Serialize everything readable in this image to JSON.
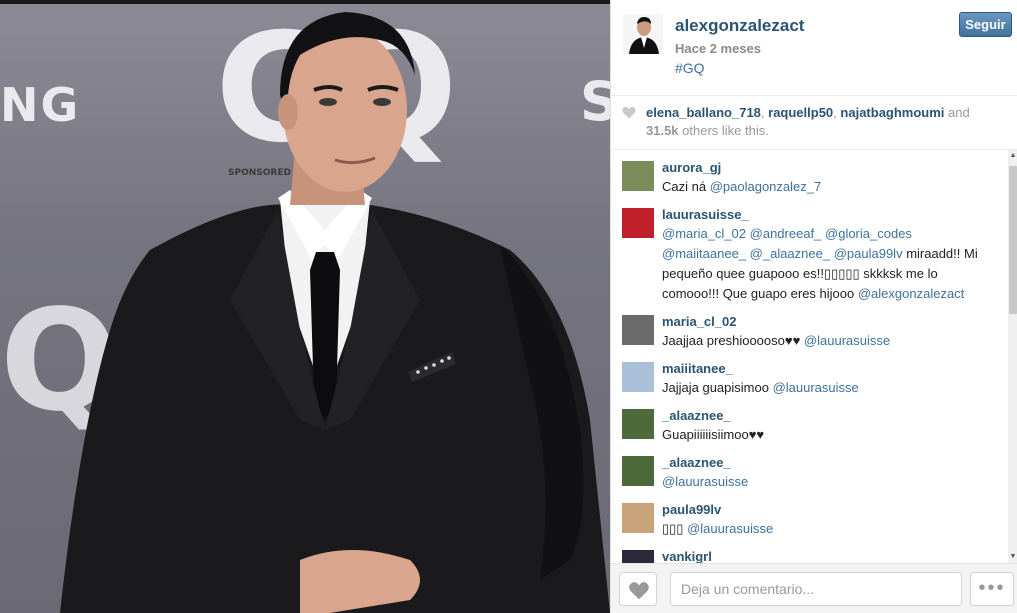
{
  "photo": {
    "alt_text": [
      "NG",
      "GQ",
      "S",
      "Q"
    ],
    "small_text": "SPONSORED BY"
  },
  "post": {
    "username": "alexgonzalezact",
    "time": "Hace 2 meses",
    "caption": "#GQ",
    "follow_label": "Seguir"
  },
  "likes": {
    "users": [
      "elena_ballano_718",
      "raquellp50",
      "najatbaghmoumi"
    ],
    "sep1": ", ",
    "sep2": ", ",
    "and": " and",
    "count": "31.5k",
    "suffix": " others like this."
  },
  "comments": [
    {
      "user": "aurora_gj",
      "parts": [
        {
          "t": "Cazi ná "
        },
        {
          "m": "@paolagonzalez_7"
        }
      ],
      "avatar_color": "#7a8c5a"
    },
    {
      "user": "lauurasuisse_",
      "parts": [
        {
          "m": "@maria_cl_02"
        },
        {
          "t": " "
        },
        {
          "m": "@andreeaf_"
        },
        {
          "t": " "
        },
        {
          "m": "@gloria_codes"
        },
        {
          "t": " "
        },
        {
          "m": "@maiitaanee_"
        },
        {
          "t": " "
        },
        {
          "m": "@_alaaznee_"
        },
        {
          "t": " "
        },
        {
          "m": "@paula99lv"
        },
        {
          "t": " miraadd!! Mi pequeño quee guapooo es!!▯▯▯▯▯ skkksk me lo comooo!!! Que guapo eres hijooo "
        },
        {
          "m": "@alexgonzalezact"
        }
      ],
      "avatar_color": "#c0202a"
    },
    {
      "user": "maria_cl_02",
      "parts": [
        {
          "t": "Jaajjaa preshiooooso♥♥ "
        },
        {
          "m": "@lauurasuisse"
        }
      ],
      "avatar_color": "#6b6b6b"
    },
    {
      "user": "maiiitanee_",
      "parts": [
        {
          "t": "Jajjaja guapisimoo "
        },
        {
          "m": "@lauurasuisse"
        }
      ],
      "avatar_color": "#a9c0d8"
    },
    {
      "user": "_alaaznee_",
      "parts": [
        {
          "t": "Guapiiiiiisiimoo♥♥"
        }
      ],
      "avatar_color": "#4d6b3a"
    },
    {
      "user": "_alaaznee_",
      "parts": [
        {
          "m": "@lauurasuisse"
        }
      ],
      "avatar_color": "#4d6b3a"
    },
    {
      "user": "paula99lv",
      "parts": [
        {
          "t": "▯▯▯ "
        },
        {
          "m": "@lauurasuisse"
        }
      ],
      "avatar_color": "#c9a37a"
    },
    {
      "user": "vankigrl",
      "parts": [
        {
          "t": ""
        }
      ],
      "avatar_color": "#2a2a3a"
    }
  ],
  "footer": {
    "comment_placeholder": "Deja un comentario...",
    "more_label": "•••"
  },
  "colors": {
    "username": "#2b5473",
    "mention": "#3f729b",
    "follow_button": "#3f729b"
  },
  "icons": {
    "like": "heart-icon",
    "more": "ellipsis-icon"
  }
}
